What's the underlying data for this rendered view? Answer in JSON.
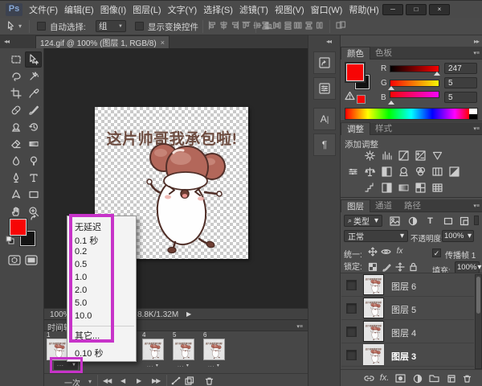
{
  "window": {
    "app_logo": "Ps",
    "controls": {
      "minimize": "─",
      "maximize": "□",
      "close": "×"
    }
  },
  "menu_bar": {
    "items": [
      {
        "label": "文件(F)"
      },
      {
        "label": "编辑(E)"
      },
      {
        "label": "图像(I)"
      },
      {
        "label": "图层(L)"
      },
      {
        "label": "文字(Y)"
      },
      {
        "label": "选择(S)"
      },
      {
        "label": "滤镜(T)"
      },
      {
        "label": "视图(V)"
      },
      {
        "label": "窗口(W)"
      },
      {
        "label": "帮助(H)"
      }
    ]
  },
  "options_bar": {
    "auto_select_label": "自动选择:",
    "auto_select_value": "组",
    "show_transform_label": "显示变换控件"
  },
  "document_tab": {
    "title": "124.gif @ 100% (图层 1, RGB/8) *",
    "close": "×"
  },
  "canvas": {
    "artwork_caption": "这片帅哥我承包啦!"
  },
  "status_bar": {
    "zoom": "100%",
    "doc_size": "8.8K/1.32M"
  },
  "delay_menu": {
    "items": [
      {
        "label": "无延迟"
      },
      {
        "label": "0.1 秒"
      },
      {
        "label": "0.2"
      },
      {
        "label": "0.5"
      },
      {
        "label": "1.0"
      },
      {
        "label": "2.0"
      },
      {
        "label": "5.0"
      },
      {
        "label": "10.0"
      },
      {
        "label": "其它..."
      },
      {
        "label": "0.10 秒"
      }
    ]
  },
  "timeline": {
    "tab": "时间轴",
    "loop_option": "一次",
    "frames": [
      {
        "number": "1"
      },
      {
        "number": "4"
      },
      {
        "number": "5"
      },
      {
        "number": "6"
      }
    ],
    "frame_delay_dots": "..."
  },
  "color_panel": {
    "tabs": [
      {
        "label": "颜色"
      },
      {
        "label": "色板"
      }
    ],
    "channels": [
      {
        "label": "R",
        "value": "247"
      },
      {
        "label": "G",
        "value": "5"
      },
      {
        "label": "B",
        "value": "5"
      }
    ]
  },
  "adjustments_panel": {
    "tabs": [
      {
        "label": "调整"
      },
      {
        "label": "样式"
      }
    ],
    "add_label": "添加调整"
  },
  "layers_panel": {
    "tabs": [
      {
        "label": "图层"
      },
      {
        "label": "通道"
      },
      {
        "label": "路径"
      }
    ],
    "filter_label": "类型",
    "blend_mode": "正常",
    "opacity_label": "不透明度:",
    "opacity_value": "100%",
    "unify_label": "统一:",
    "propagate_label": "传播帧 1",
    "lock_label": "锁定:",
    "fill_label": "填充:",
    "fill_value": "100%",
    "fx_label": "fx.",
    "layers": [
      {
        "name": "图层 6"
      },
      {
        "name": "图层 5"
      },
      {
        "name": "图层 4"
      },
      {
        "name": "图层 3"
      }
    ]
  },
  "colors": {
    "foreground_red": "#f70505",
    "annotation_magenta": "#c733c9"
  }
}
